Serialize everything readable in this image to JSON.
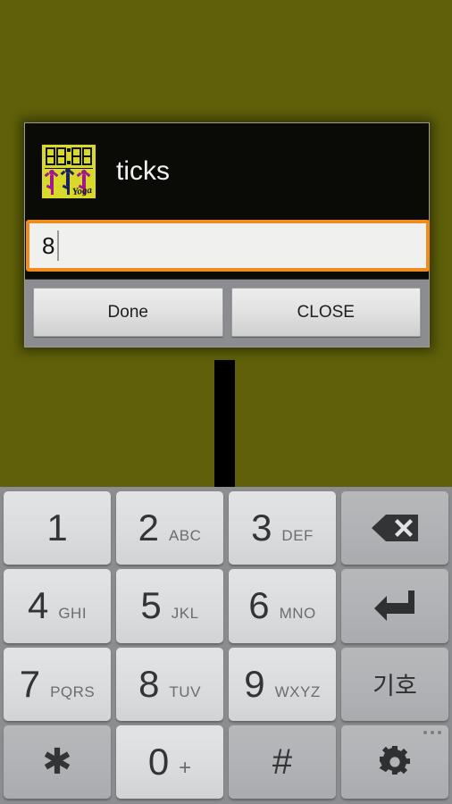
{
  "background_color": "#5f6009",
  "dialog": {
    "title": "ticks",
    "icon_name": "ticks-app-icon",
    "icon_word": "Yoga",
    "input": {
      "value": "8",
      "placeholder": ""
    },
    "buttons": [
      {
        "label": "Done",
        "name": "done-button"
      },
      {
        "label": "CLOSE",
        "name": "close-button"
      }
    ]
  },
  "keyboard": {
    "type": "numeric-phone-pad",
    "rows": [
      [
        {
          "digit": "1",
          "letters": "",
          "style": "light",
          "name": "key-1"
        },
        {
          "digit": "2",
          "letters": "ABC",
          "style": "light",
          "name": "key-2"
        },
        {
          "digit": "3",
          "letters": "DEF",
          "style": "light",
          "name": "key-3"
        },
        {
          "digit": "",
          "letters": "",
          "style": "dark",
          "name": "key-backspace",
          "icon": "backspace-icon"
        }
      ],
      [
        {
          "digit": "4",
          "letters": "GHI",
          "style": "light",
          "name": "key-4"
        },
        {
          "digit": "5",
          "letters": "JKL",
          "style": "light",
          "name": "key-5"
        },
        {
          "digit": "6",
          "letters": "MNO",
          "style": "light",
          "name": "key-6"
        },
        {
          "digit": "",
          "letters": "",
          "style": "dark",
          "name": "key-enter",
          "icon": "enter-icon"
        }
      ],
      [
        {
          "digit": "7",
          "letters": "PQRS",
          "style": "light",
          "name": "key-7"
        },
        {
          "digit": "8",
          "letters": "TUV",
          "style": "light",
          "name": "key-8"
        },
        {
          "digit": "9",
          "letters": "WXYZ",
          "style": "light",
          "name": "key-9"
        },
        {
          "digit": "",
          "letters": "",
          "style": "dark",
          "name": "key-symbol",
          "label": "기호"
        }
      ],
      [
        {
          "digit": "",
          "letters": "",
          "style": "dark",
          "name": "key-asterisk",
          "char": "✱"
        },
        {
          "digit": "0",
          "letters": "+",
          "style": "light",
          "name": "key-0"
        },
        {
          "digit": "",
          "letters": "",
          "style": "dark",
          "name": "key-hash",
          "char": "#"
        },
        {
          "digit": "",
          "letters": "",
          "style": "dark",
          "name": "key-settings",
          "icon": "gear-icon"
        }
      ]
    ]
  }
}
